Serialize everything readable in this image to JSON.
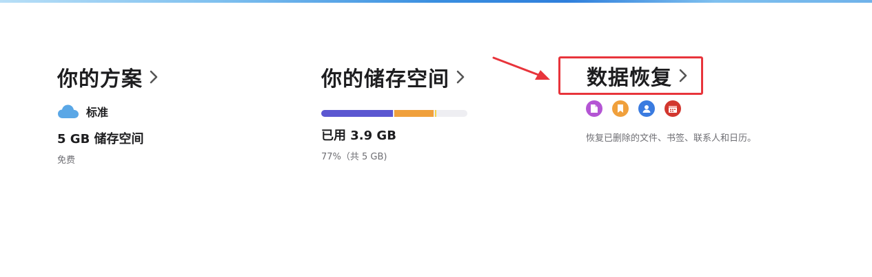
{
  "colors": {
    "accent_red": "#e8343b",
    "cloud_blue": "#5aa7e6",
    "storage_purple": "#5b57d1",
    "storage_orange": "#f0a03c",
    "storage_yellow": "#f5d34a",
    "files_icon": "#b455d4",
    "bookmarks_icon": "#f0a03c",
    "contacts_icon": "#3a7be0",
    "calendars_icon": "#d2372f"
  },
  "plan": {
    "title": "你的方案",
    "tier_icon": "cloud-icon",
    "tier": "标准",
    "capacity": "5 GB 储存空间",
    "price": "免费"
  },
  "storage": {
    "title": "你的储存空间",
    "used_label": "已用 3.9 GB",
    "detail": "77%（共 5 GB)",
    "segments": [
      {
        "name": "segment-a",
        "fraction": 0.49,
        "color": "#5b57d1"
      },
      {
        "name": "segment-b",
        "fraction": 0.27,
        "color": "#f0a03c"
      },
      {
        "name": "segment-c",
        "fraction": 0.01,
        "color": "#f5d34a"
      }
    ]
  },
  "recovery": {
    "title": "数据恢复",
    "icons": [
      "file-icon",
      "bookmark-icon",
      "contact-icon",
      "calendar-icon"
    ],
    "description": "恢复已删除的文件、书签、联系人和日历。"
  }
}
